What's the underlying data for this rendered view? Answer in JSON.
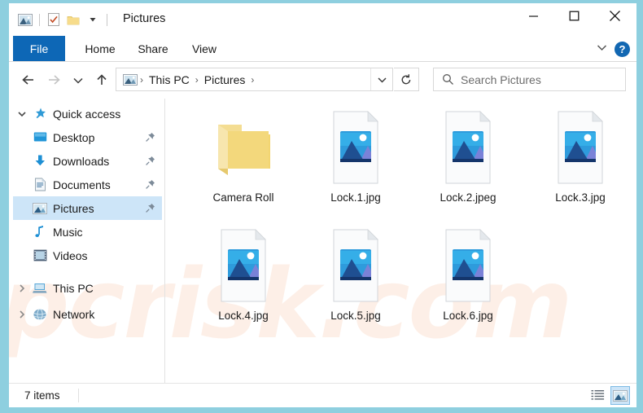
{
  "window": {
    "title": "Pictures",
    "quick_access_icons": [
      "picture-library-icon",
      "properties-check-icon",
      "new-folder-icon",
      "customize-qat-chevron-icon"
    ],
    "controls": {
      "minimize": "─",
      "maximize": "□",
      "close": "✕"
    },
    "frame_color": "#8ecfdf"
  },
  "ribbon": {
    "tabs": [
      {
        "label": "File",
        "active": true
      },
      {
        "label": "Home",
        "active": false
      },
      {
        "label": "Share",
        "active": false
      },
      {
        "label": "View",
        "active": false
      }
    ],
    "collapse_icon": "chevron-down-icon",
    "help_label": "?",
    "active_tab_color": "#0d67b6"
  },
  "navigation": {
    "back_icon": "arrow-left-icon",
    "forward_icon": "arrow-right-icon",
    "recent_icon": "chevron-down-icon",
    "up_icon": "arrow-up-icon",
    "breadcrumb": {
      "root_icon": "picture-library-icon",
      "parts": [
        "This PC",
        "Pictures"
      ],
      "separator": "›",
      "dropdown_icon": "chevron-down-icon"
    },
    "refresh_icon": "refresh-icon"
  },
  "search": {
    "icon": "search-icon",
    "placeholder": "Search Pictures",
    "value": ""
  },
  "sidebar": {
    "items": [
      {
        "label": "Quick access",
        "icon": "star-pin-icon",
        "chevron": "expanded",
        "indent": 0,
        "pinned": false,
        "selected": false
      },
      {
        "label": "Desktop",
        "icon": "desktop-icon",
        "chevron": "none",
        "indent": 1,
        "pinned": true,
        "selected": false
      },
      {
        "label": "Downloads",
        "icon": "downloads-icon",
        "chevron": "none",
        "indent": 1,
        "pinned": true,
        "selected": false
      },
      {
        "label": "Documents",
        "icon": "documents-icon",
        "chevron": "none",
        "indent": 1,
        "pinned": true,
        "selected": false
      },
      {
        "label": "Pictures",
        "icon": "pictures-icon",
        "chevron": "none",
        "indent": 1,
        "pinned": true,
        "selected": true
      },
      {
        "label": "Music",
        "icon": "music-note-icon",
        "chevron": "none",
        "indent": 1,
        "pinned": false,
        "selected": false
      },
      {
        "label": "Videos",
        "icon": "videos-icon",
        "chevron": "none",
        "indent": 1,
        "pinned": false,
        "selected": false
      },
      {
        "label": "This PC",
        "icon": "this-pc-icon",
        "chevron": "collapsed",
        "indent": 0,
        "pinned": false,
        "selected": false
      },
      {
        "label": "Network",
        "icon": "network-icon",
        "chevron": "collapsed",
        "indent": 0,
        "pinned": false,
        "selected": false
      }
    ],
    "selection_color": "#cde5f8"
  },
  "files": [
    {
      "name": "Camera Roll",
      "type": "folder"
    },
    {
      "name": "Lock.1.jpg",
      "type": "image"
    },
    {
      "name": "Lock.2.jpeg",
      "type": "image"
    },
    {
      "name": "Lock.3.jpg",
      "type": "image"
    },
    {
      "name": "Lock.4.jpg",
      "type": "image"
    },
    {
      "name": "Lock.5.jpg",
      "type": "image"
    },
    {
      "name": "Lock.6.jpg",
      "type": "image"
    }
  ],
  "status": {
    "count_text": "7 items",
    "details_view_icon": "details-view-icon",
    "thumbnail_view_icon": "large-icons-view-icon",
    "active_view": "large-icons-view-icon"
  },
  "watermark": {
    "grey_text": "PCrisk",
    "orange_text": "pcrisk.com"
  }
}
